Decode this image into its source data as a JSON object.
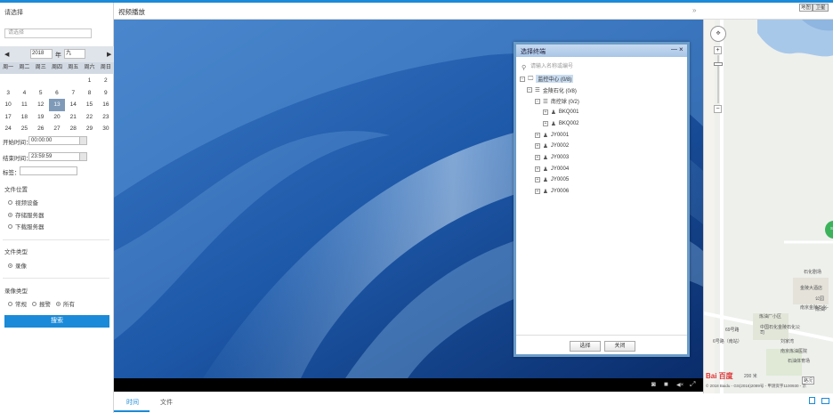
{
  "left_panel": {
    "title": "请选择",
    "select_placeholder": "请选择",
    "calendar": {
      "prev": "◀",
      "next": "▶",
      "year": "2018",
      "year_label": "年",
      "month": "九",
      "weekdays": [
        "周一",
        "周二",
        "周三",
        "周四",
        "周五",
        "周六",
        "周日"
      ],
      "weeks": [
        [
          "",
          "",
          "",
          "",
          "",
          "1",
          "2"
        ],
        [
          "3",
          "4",
          "5",
          "6",
          "7",
          "8",
          "9"
        ],
        [
          "10",
          "11",
          "12",
          "13",
          "14",
          "15",
          "16"
        ],
        [
          "17",
          "18",
          "19",
          "20",
          "21",
          "22",
          "23"
        ],
        [
          "24",
          "25",
          "26",
          "27",
          "28",
          "29",
          "30"
        ]
      ],
      "selected_day": "13"
    },
    "start_label": "开始时间：",
    "start_value": "00:00:00",
    "end_label": "结束时间：",
    "end_value": "23:59:59",
    "tag_label": "标签：",
    "file_location": {
      "title": "文件位置",
      "options": [
        "视频设备",
        "存储服务器",
        "下载服务器"
      ],
      "selected": 1
    },
    "file_type": {
      "title": "文件类型",
      "options": [
        "录像"
      ],
      "selected": 0
    },
    "record_type": {
      "title": "录像类型",
      "options": [
        "常规",
        "报警",
        "所有"
      ],
      "selected": 2
    },
    "search_button": "搜索"
  },
  "video": {
    "title": "视频播放",
    "collapse": "»",
    "tabs": [
      "时间",
      "文件"
    ],
    "controls": {
      "snapshot": "◙",
      "stop": "■",
      "volume": "◀×",
      "fullscreen": "⤢"
    }
  },
  "dialog": {
    "title": "选择终端",
    "minimize": "—",
    "close": "×",
    "search_placeholder": "请输入名称或编号",
    "tree": [
      {
        "label": "监控中心 (0/8)",
        "level": 0,
        "icon": "monitor-icon",
        "highlight": true
      },
      {
        "label": "金陵石化 (0/8)",
        "level": 1,
        "icon": "list-icon"
      },
      {
        "label": "南控球 (0/2)",
        "level": 2,
        "icon": "list-icon"
      },
      {
        "label": "BKQ001",
        "level": 3,
        "icon": "person-icon"
      },
      {
        "label": "BKQ002",
        "level": 3,
        "icon": "person-icon"
      },
      {
        "label": "JY0001",
        "level": 2,
        "icon": "person-icon"
      },
      {
        "label": "JY0002",
        "level": 2,
        "icon": "person-icon"
      },
      {
        "label": "JY0003",
        "level": 2,
        "icon": "person-icon"
      },
      {
        "label": "JY0004",
        "level": 2,
        "icon": "person-icon"
      },
      {
        "label": "JY0005",
        "level": 2,
        "icon": "person-icon"
      },
      {
        "label": "JY0006",
        "level": 2,
        "icon": "person-icon"
      }
    ],
    "ok": "选择",
    "cancel": "关闭"
  },
  "map": {
    "map_type_normal": "地图",
    "map_type_satellite": "卫星",
    "labels": [
      "石化剧场",
      "金陵大酒店",
      "公园",
      "南京金陵石化",
      "炼油厂小区",
      "中国石化金陵石化公司",
      "6号路（南站）",
      "刘家湾",
      "南京炼油医院",
      "69号路",
      "石油体育场",
      "炼油厂"
    ],
    "scale": "200 米",
    "copyright": "© 2018 Baidu - GS(2016)2089号 - 甲测资字1100930 - 京",
    "baidu": "Bai 百度",
    "street": "路况",
    "stop": "ST"
  }
}
